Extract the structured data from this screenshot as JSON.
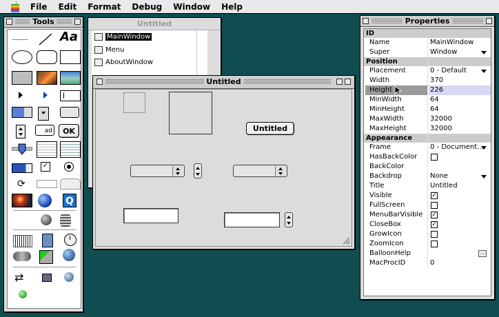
{
  "menubar": {
    "items": [
      "File",
      "Edit",
      "Format",
      "Debug",
      "Window",
      "Help"
    ]
  },
  "tools": {
    "title": "Tools",
    "text_tool_label": "Aa",
    "ok_label": "OK",
    "ad_label": "ad"
  },
  "list_window": {
    "title": "Untitled",
    "items": [
      "MainWindow",
      "Menu",
      "AboutWindow"
    ]
  },
  "untitled_window": {
    "title": "Untitled",
    "button_label": "Untitled"
  },
  "properties": {
    "title": "Properties",
    "sections": [
      {
        "name": "ID",
        "rows": [
          {
            "key": "Name",
            "value": "MainWindow"
          },
          {
            "key": "Super",
            "value": "Window",
            "dropdown": true
          }
        ]
      },
      {
        "name": "Position",
        "rows": [
          {
            "key": "Placement",
            "value": "0 - Default",
            "dropdown": true
          },
          {
            "key": "Width",
            "value": "370"
          },
          {
            "key": "Height",
            "value": "226",
            "highlight": true
          },
          {
            "key": "MinWidth",
            "value": "64"
          },
          {
            "key": "MinHeight",
            "value": "64"
          },
          {
            "key": "MaxWidth",
            "value": "32000"
          },
          {
            "key": "MaxHeight",
            "value": "32000"
          }
        ]
      },
      {
        "name": "Appearance",
        "rows": [
          {
            "key": "Frame",
            "value": "0 - Document...",
            "dropdown": true
          },
          {
            "key": "HasBackColor",
            "check": false
          },
          {
            "key": "BackColor",
            "value": ""
          },
          {
            "key": "Backdrop",
            "value": "None",
            "dropdown": true
          },
          {
            "key": "Title",
            "value": "Untitled"
          },
          {
            "key": "Visible",
            "check": true
          },
          {
            "key": "FullScreen",
            "check": false
          },
          {
            "key": "MenuBarVisible",
            "check": true
          },
          {
            "key": "CloseBox",
            "check": true
          },
          {
            "key": "GrowIcon",
            "check": false
          },
          {
            "key": "ZoomIcon",
            "check": false
          },
          {
            "key": "BalloonHelp",
            "value": "",
            "ellipsis": true
          },
          {
            "key": "MacProcID",
            "value": "0"
          }
        ]
      }
    ]
  },
  "colors": {
    "desktop": "#0f4d51",
    "window_bg": "#dedede",
    "highlight_row": "#d8d8f4"
  }
}
